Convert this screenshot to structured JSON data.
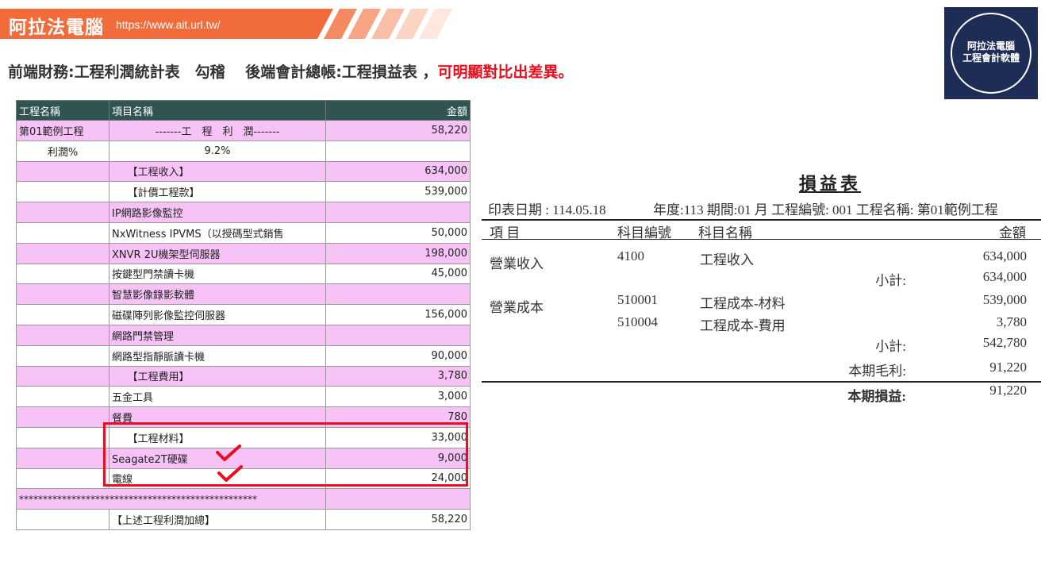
{
  "banner": {
    "title": "阿拉法電腦",
    "url": "https://www.ait.url.tw/"
  },
  "subtitle": {
    "main": "前端財務:工程利潤統計表　勾稽　 後端會計總帳:工程損益表 ，",
    "highlight": "可明顯對比出差異。"
  },
  "badge": {
    "line1": "阿拉法電腦",
    "line2": "工程會計軟體"
  },
  "colors": {
    "banner": "#f26b3a",
    "pink_row": "#f7c3f7",
    "header": "#2f5451",
    "highlight": "#e8101f",
    "badge": "#1e2d55"
  },
  "left_table": {
    "headers": {
      "project": "工程名稱",
      "item": "項目名稱",
      "amount": "金額"
    },
    "rows": [
      {
        "project": "第01範例工程",
        "item": "-------工　程　利　潤-------",
        "amount": "58,220"
      },
      {
        "project": "利潤%",
        "item": "9.2%",
        "amount": ""
      },
      {
        "project": "",
        "item": "　　【工程收入】",
        "amount": "634,000"
      },
      {
        "project": "",
        "item": "　　【計價工程款】",
        "amount": "539,000"
      },
      {
        "project": "",
        "item": "IP網路影像監控",
        "amount": ""
      },
      {
        "project": "",
        "item": "NxWitness IPVMS（以授碼型式銷售",
        "amount": "50,000"
      },
      {
        "project": "",
        "item": "XNVR 2U機架型伺服器",
        "amount": "198,000"
      },
      {
        "project": "",
        "item": "按鍵型門禁讀卡機",
        "amount": "45,000"
      },
      {
        "project": "",
        "item": "智慧影像錄影軟體",
        "amount": ""
      },
      {
        "project": "",
        "item": "磁碟陣列影像監控伺服器",
        "amount": "156,000"
      },
      {
        "project": "",
        "item": "網路門禁管理",
        "amount": ""
      },
      {
        "project": "",
        "item": "網路型指靜脈讀卡機",
        "amount": "90,000"
      },
      {
        "project": "",
        "item": "　　【工程費用】",
        "amount": "3,780"
      },
      {
        "project": "",
        "item": "五金工具",
        "amount": "3,000"
      },
      {
        "project": "",
        "item": "餐費",
        "amount": "780"
      },
      {
        "project": "",
        "item": "　　【工程材料】",
        "amount": "33,000"
      },
      {
        "project": "",
        "item": "Seagate2T硬碟",
        "amount": "9,000"
      },
      {
        "project": "",
        "item": "電線",
        "amount": "24,000"
      },
      {
        "project": "",
        "item": "",
        "amount": ""
      },
      {
        "project": "",
        "item": "【上述工程利潤加總】",
        "amount": "58,220"
      }
    ],
    "stars": "**************************************************"
  },
  "income": {
    "title": "損益表",
    "meta_date": "印表日期 : 114.05.18",
    "meta_info": "年度:113 期間:01 月 工程編號: 001 工程名稱: 第01範例工程",
    "col_item": "項 目",
    "col_code": "科目編號",
    "col_name": "科目名稱",
    "col_amount": "金額",
    "revenue_label": "營業收入",
    "rev_code": "4100",
    "rev_name": "工程收入",
    "rev_amount": "634,000",
    "rev_subtotal_label": "小計:",
    "rev_subtotal": "634,000",
    "cost_label": "營業成本",
    "cost1_code": "510001",
    "cost1_name": "工程成本-材料",
    "cost1_amount": "539,000",
    "cost2_code": "510004",
    "cost2_name": "工程成本-費用",
    "cost2_amount": "3,780",
    "cost_subtotal_label": "小計:",
    "cost_subtotal": "542,780",
    "gross_label": "本期毛利:",
    "gross": "91,220",
    "net_label": "本期損益:",
    "net": "91,220"
  }
}
